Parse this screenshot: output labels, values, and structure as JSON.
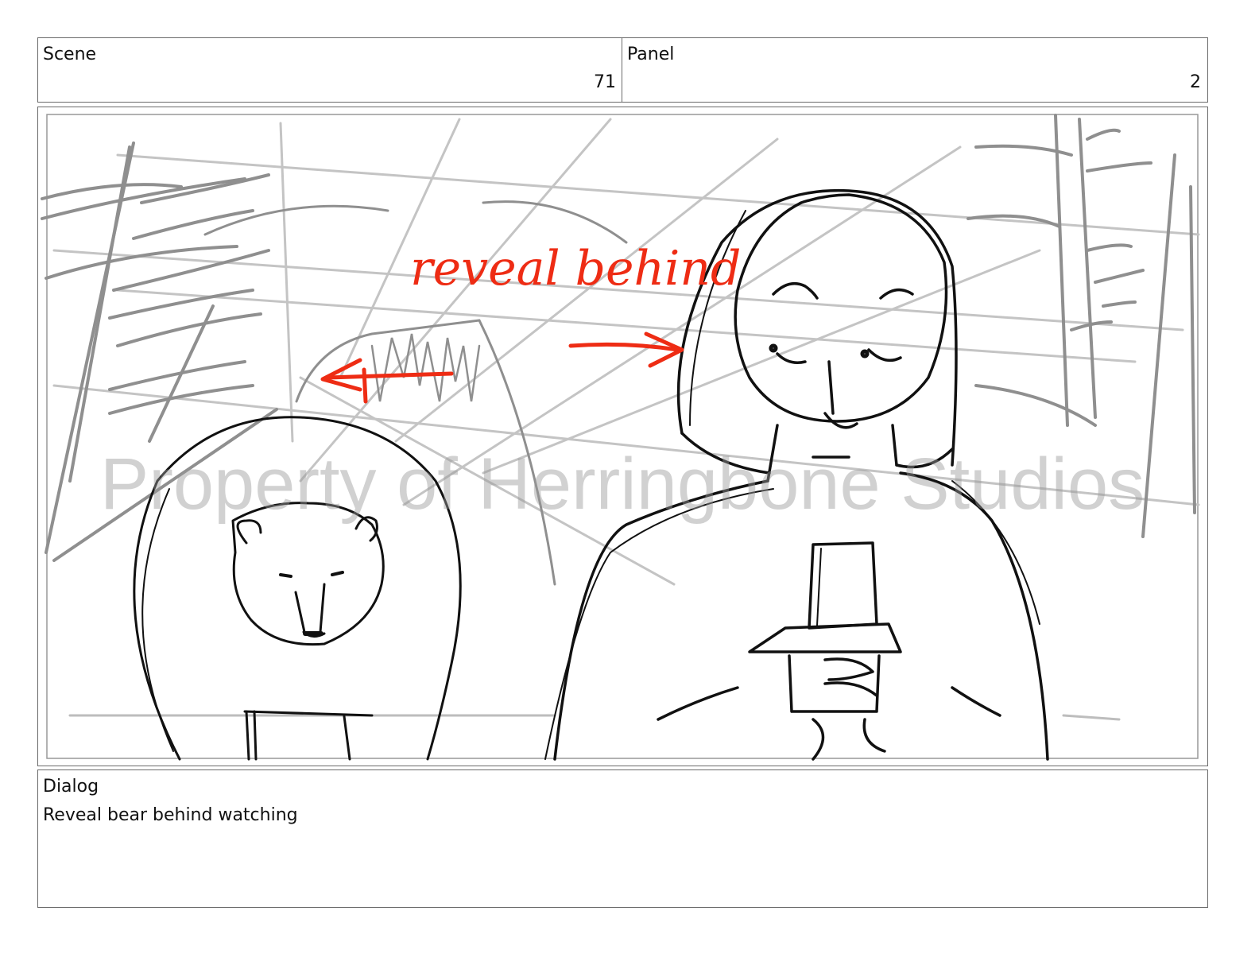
{
  "scene": {
    "label": "Scene",
    "number": "71"
  },
  "panel": {
    "label": "Panel",
    "number": "2"
  },
  "artwork": {
    "annotation": "reveal behind",
    "watermark": "Property of Herringbone Studios",
    "annotation_color": "#ee2c14"
  },
  "dialog": {
    "label": "Dialog",
    "text": "Reveal bear behind watching"
  }
}
